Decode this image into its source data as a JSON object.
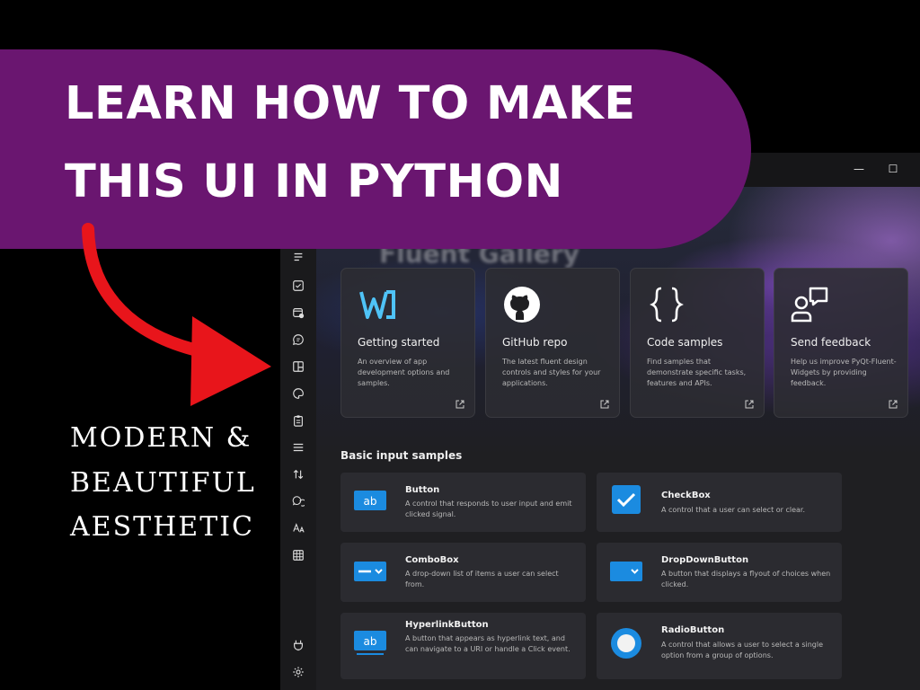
{
  "banner": {
    "line1": "LEARN HOW TO MAKE",
    "line2": "THIS UI IN PYTHON"
  },
  "tagline": {
    "line1": "MODERN &",
    "line2": "BEAUTIFUL",
    "line3": "AESTHETIC"
  },
  "window": {
    "minimize_glyph": "—",
    "maximize_glyph": "☐",
    "hero_title": "Fluent Gallery"
  },
  "nav": {
    "items": [
      "list-icon",
      "checkbox-icon",
      "date-time-icon",
      "chat-icon",
      "layout-icon",
      "palette-icon",
      "clipboard-icon",
      "menu-icon",
      "sort-icon",
      "dialog-icon",
      "text-icon",
      "table-icon",
      "plugin-icon",
      "settings-icon"
    ]
  },
  "cards": [
    {
      "title": "Getting started",
      "desc": "An overview of app development options and samples.",
      "icon": "fluent-logo-icon"
    },
    {
      "title": "GitHub repo",
      "desc": "The latest fluent design controls and styles for your applications.",
      "icon": "github-icon"
    },
    {
      "title": "Code samples",
      "desc": "Find samples that demonstrate specific tasks, features and APIs.",
      "icon": "braces-icon"
    },
    {
      "title": "Send feedback",
      "desc": "Help us improve PyQt-Fluent-Widgets by providing feedback.",
      "icon": "feedback-icon"
    }
  ],
  "section": {
    "title": "Basic input samples"
  },
  "samples": [
    {
      "name": "Button",
      "desc": "A control that responds to user input and emit clicked signal."
    },
    {
      "name": "CheckBox",
      "desc": "A control that a user can select or clear."
    },
    {
      "name": "ComboBox",
      "desc": "A drop-down list of items a user can select from."
    },
    {
      "name": "DropDownButton",
      "desc": "A button that displays a flyout of choices when clicked."
    },
    {
      "name": "HyperlinkButton",
      "desc": "A button that appears as hyperlink text, and can navigate to a URI or handle a Click event."
    },
    {
      "name": "RadioButton",
      "desc": "A control that allows a user to select a single option from a group of options."
    }
  ],
  "sample_icon_text": {
    "button": "ab",
    "hyperlink": "ab"
  },
  "colors": {
    "banner": "#6a1670",
    "arrow": "#e8151b",
    "accent": "#1b8be0"
  }
}
